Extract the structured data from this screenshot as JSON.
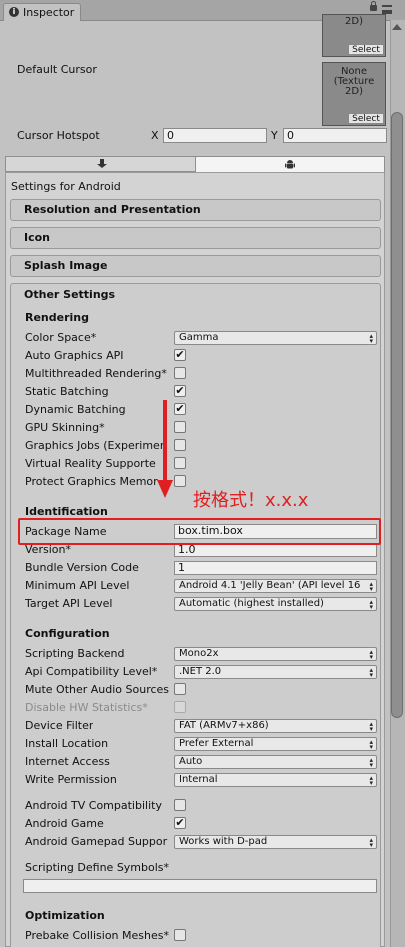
{
  "window": {
    "tab_title": "Inspector"
  },
  "cursor": {
    "top_texture_text": "2D)",
    "select_label": "Select",
    "default_cursor_label": "Default Cursor",
    "none_texture_text": [
      "None",
      "(Texture",
      "2D)"
    ],
    "hotspot_label": "Cursor Hotspot",
    "x_label": "X",
    "x_value": "0",
    "y_label": "Y",
    "y_value": "0"
  },
  "platform": {
    "settings_for": "Settings for Android"
  },
  "sections": {
    "resolution": "Resolution and Presentation",
    "icon": "Icon",
    "splash": "Splash Image",
    "other": "Other Settings"
  },
  "rendering": {
    "header": "Rendering",
    "color_space_label": "Color Space*",
    "color_space_value": "Gamma",
    "auto_graphics_label": "Auto Graphics API",
    "auto_graphics": true,
    "multithreaded_label": "Multithreaded Rendering*",
    "multithreaded": false,
    "static_batching_label": "Static Batching",
    "static_batching": true,
    "dynamic_batching_label": "Dynamic Batching",
    "dynamic_batching": true,
    "gpu_skinning_label": "GPU Skinning*",
    "gpu_skinning": false,
    "graphics_jobs_label": "Graphics Jobs (Experimen",
    "graphics_jobs": false,
    "vr_label": "Virtual Reality Supporte",
    "vr": false,
    "protect_graphics_label": "Protect Graphics Memor",
    "protect_graphics": false
  },
  "identification": {
    "header": "Identification",
    "package_name_label": "Package Name",
    "package_name_value": "box.tim.box",
    "version_label": "Version*",
    "version_value": "1.0",
    "bundle_code_label": "Bundle Version Code",
    "bundle_code_value": "1",
    "min_api_label": "Minimum API Level",
    "min_api_value": "Android 4.1 'Jelly Bean' (API level 16",
    "target_api_label": "Target API Level",
    "target_api_value": "Automatic (highest installed)"
  },
  "configuration": {
    "header": "Configuration",
    "scripting_backend_label": "Scripting Backend",
    "scripting_backend_value": "Mono2x",
    "api_compat_label": "Api Compatibility Level*",
    "api_compat_value": ".NET 2.0",
    "mute_audio_label": "Mute Other Audio Sources",
    "mute_audio": false,
    "disable_hw_label": "Disable HW Statistics*",
    "disable_hw": false,
    "device_filter_label": "Device Filter",
    "device_filter_value": "FAT (ARMv7+x86)",
    "install_location_label": "Install Location",
    "install_location_value": "Prefer External",
    "internet_access_label": "Internet Access",
    "internet_access_value": "Auto",
    "write_permission_label": "Write Permission",
    "write_permission_value": "Internal",
    "android_tv_label": "Android TV Compatibility",
    "android_tv": false,
    "android_game_label": "Android Game",
    "android_game": true,
    "gamepad_label": "Android Gamepad Suppor",
    "gamepad_value": "Works with D-pad",
    "define_symbols_label": "Scripting Define Symbols*",
    "define_symbols_value": ""
  },
  "optimization": {
    "header": "Optimization",
    "prebake_label": "Prebake Collision Meshes*",
    "prebake": false
  },
  "annotation": {
    "text": "按格式！x.x.x",
    "color": "#e02020"
  },
  "icons": {
    "tab_icon": "info-icon",
    "lock": "lock-icon",
    "menu": "menu-icon",
    "standalone": "download-icon",
    "android": "android-icon",
    "check": "✔",
    "dropdown": "▴▾"
  }
}
